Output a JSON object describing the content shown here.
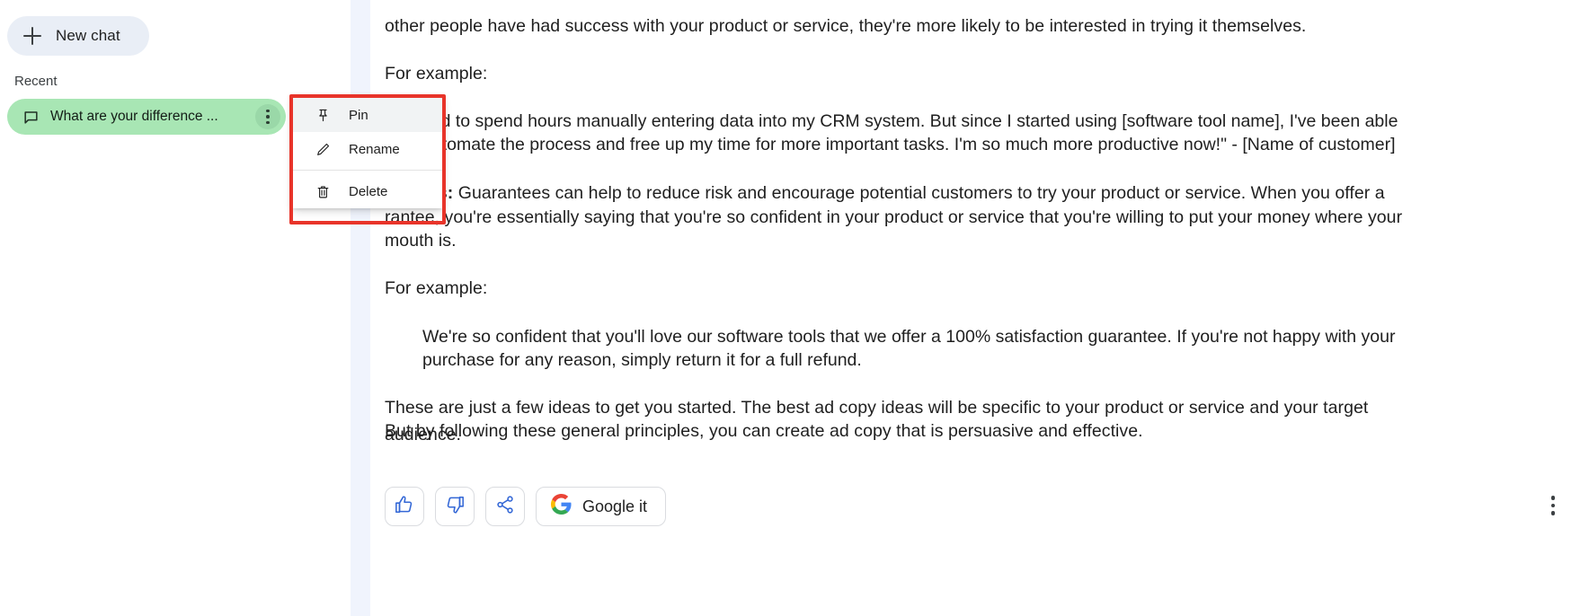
{
  "sidebar": {
    "new_chat_label": "New chat",
    "recent_label": "Recent",
    "chat_item": {
      "title": "What are your difference ...",
      "icon": "chat-bubble-icon",
      "kebab_icon": "more-vert-icon"
    }
  },
  "context_menu": {
    "items": [
      {
        "label": "Pin",
        "icon": "pin-icon"
      },
      {
        "label": "Rename",
        "icon": "pencil-icon"
      },
      {
        "label": "Delete",
        "icon": "trash-icon"
      }
    ],
    "highlight_color": "#e8342a"
  },
  "conversation": {
    "paragraph_1": "other people have had success with your product or service, they're more likely to be interested in trying it themselves.",
    "for_example_1": "For example:",
    "quote_1_line_1": "sed to spend hours manually entering data into my CRM system. But since I started using [software tool name], I've been able",
    "quote_1_line_2": "automate the process and free up my time for more important tasks. I'm so much more productive now!\" - [Name of customer]",
    "guarantees_bold": "rantees:",
    "guarantees_rest": " Guarantees can help to reduce risk and encourage potential customers to try your product or service. When you offer a",
    "guarantees_line_2": "rantee, you're essentially saying that you're so confident in your product or service that you're willing to put your money where your",
    "guarantees_line_3": "mouth is.",
    "for_example_2": "For example:",
    "quote_2_line_1": "We're so confident that you'll love our software tools that we offer a 100% satisfaction guarantee. If you're not happy with your",
    "quote_2_line_2": "purchase for any reason, simply return it for a full refund.",
    "closing_line_1": "These are just a few ideas to get you started. The best ad copy ideas will be specific to your product or service and your target audience.",
    "closing_line_2": "But by following these general principles, you can create ad copy that is persuasive and effective."
  },
  "action_bar": {
    "thumb_up_icon": "thumb-up-icon",
    "thumb_down_icon": "thumb-down-icon",
    "share_icon": "share-icon",
    "google_it_label": "Google it",
    "google_icon": "google-g-icon",
    "more_options_icon": "more-vert-icon",
    "icon_color": "#3367d6"
  }
}
